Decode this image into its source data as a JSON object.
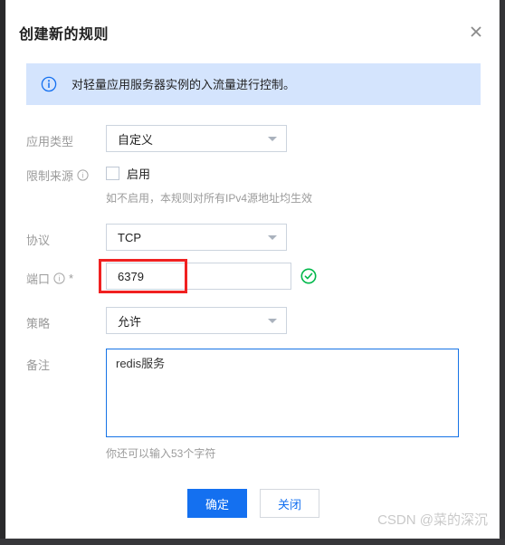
{
  "dialog": {
    "title": "创建新的规则",
    "close_icon": "close-icon"
  },
  "banner": {
    "icon": "info-circle-icon",
    "text": "对轻量应用服务器实例的入流量进行控制。"
  },
  "form": {
    "app_type": {
      "label": "应用类型",
      "value": "自定义"
    },
    "restrict_source": {
      "label": "限制来源",
      "help_icon": "question-circle-icon",
      "checkbox_label": "启用",
      "checked": false,
      "hint": "如不启用，本规则对所有IPv4源地址均生效"
    },
    "protocol": {
      "label": "协议",
      "value": "TCP"
    },
    "port": {
      "label": "端口",
      "help_icon": "question-circle-icon",
      "required_mark": "*",
      "value": "6379",
      "placeholder": "",
      "status_icon": "success-check-icon"
    },
    "policy": {
      "label": "策略",
      "value": "允许"
    },
    "remark": {
      "label": "备注",
      "value": "redis服务",
      "placeholder": "",
      "counter": "你还可以输入53个字符"
    }
  },
  "footer": {
    "confirm_label": "确定",
    "close_label": "关闭"
  },
  "watermark": {
    "text": "CSDN @菜的深沉"
  },
  "colors": {
    "primary": "#1470f0",
    "banner_bg": "#d4e4fd",
    "success": "#00b84a",
    "annotation": "#f02121"
  }
}
